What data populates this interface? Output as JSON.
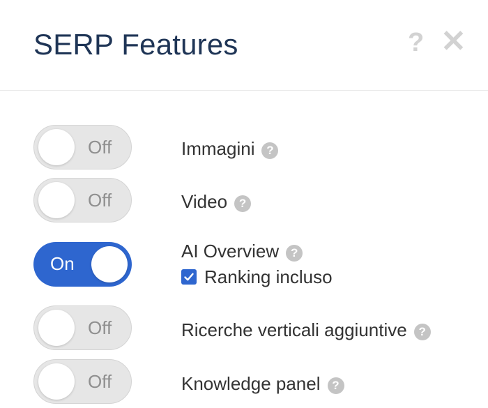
{
  "dialog": {
    "title": "SERP Features",
    "help_icon": "question-mark-icon",
    "close_icon": "close-icon"
  },
  "features": [
    {
      "label": "Immagini",
      "toggle_text": "Off",
      "state": "off"
    },
    {
      "label": "Video",
      "toggle_text": "Off",
      "state": "off"
    },
    {
      "label": "AI Overview",
      "toggle_text": "On",
      "state": "on",
      "checkbox": {
        "label": "Ranking incluso",
        "checked": true
      }
    },
    {
      "label": "Ricerche verticali aggiuntive",
      "toggle_text": "Off",
      "state": "off"
    },
    {
      "label": "Knowledge panel",
      "toggle_text": "Off",
      "state": "off"
    }
  ],
  "colors": {
    "title": "#1f3556",
    "toggle_on": "#2e66cf",
    "toggle_off": "#e6e6e6",
    "help_icon": "#c4c4c4"
  }
}
